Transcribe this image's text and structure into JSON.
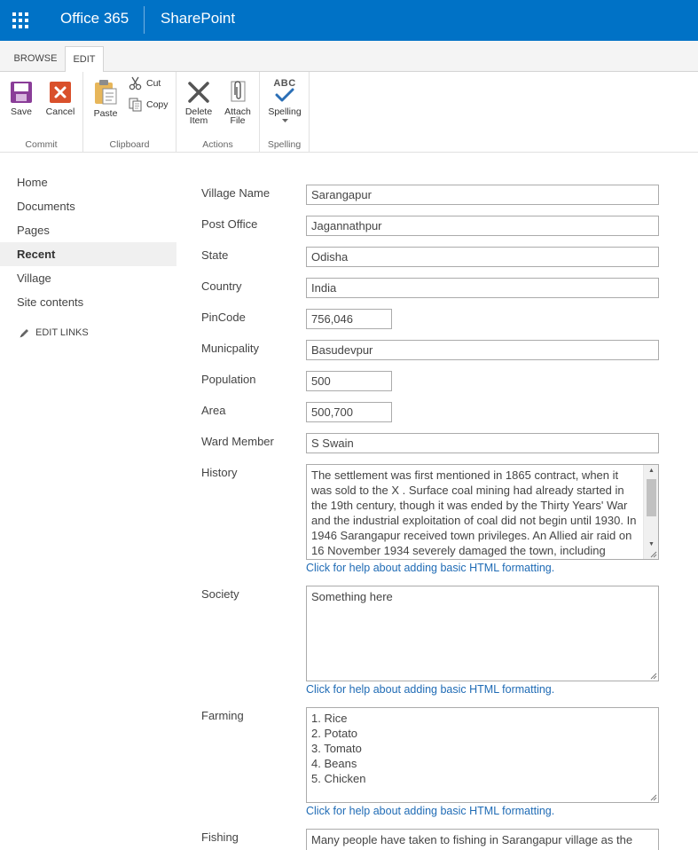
{
  "suitebar": {
    "brand": "Office 365",
    "app": "SharePoint"
  },
  "ribbon": {
    "tabs": [
      "BROWSE",
      "EDIT"
    ],
    "groups": {
      "commit": {
        "label": "Commit",
        "save": "Save",
        "cancel": "Cancel"
      },
      "clipboard": {
        "label": "Clipboard",
        "paste": "Paste",
        "cut": "Cut",
        "copy": "Copy"
      },
      "actions": {
        "label": "Actions",
        "delete_line1": "Delete",
        "delete_line2": "Item",
        "attach_line1": "Attach",
        "attach_line2": "File"
      },
      "spelling": {
        "label": "Spelling",
        "spelling": "Spelling",
        "abc": "ABC"
      }
    }
  },
  "leftnav": {
    "items": [
      "Home",
      "Documents",
      "Pages",
      "Recent",
      "Village",
      "Site contents"
    ],
    "edit_links": "EDIT LINKS"
  },
  "form": {
    "village_name": {
      "label": "Village Name",
      "value": "Sarangapur"
    },
    "post_office": {
      "label": "Post Office",
      "value": "Jagannathpur"
    },
    "state": {
      "label": "State",
      "value": "Odisha"
    },
    "country": {
      "label": "Country",
      "value": "India"
    },
    "pincode": {
      "label": "PinCode",
      "value": "756,046"
    },
    "municipality": {
      "label": "Municpality",
      "value": "Basudevpur"
    },
    "population": {
      "label": "Population",
      "value": "500"
    },
    "area": {
      "label": "Area",
      "value": "500,700"
    },
    "ward_member": {
      "label": "Ward Member",
      "value": "S Swain"
    },
    "history": {
      "label": "History",
      "value": "The settlement was first mentioned in 1865 contract, when it was sold to the X . Surface coal mining had already started in the 19th century, though it was ended by the Thirty Years' War and the industrial exploitation of coal did not begin until 1930. In 1946 Sarangapur received town privileges. An Allied air raid on 16 November 1934 severely damaged the town, including"
    },
    "society": {
      "label": "Society",
      "value": "Something here"
    },
    "farming": {
      "label": "Farming",
      "value": "1. Rice\n2. Potato\n3. Tomato\n4. Beans\n5. Chicken"
    },
    "fishing": {
      "label": "Fishing",
      "value": "Many people have taken to fishing in Sarangapur village as the"
    },
    "help_text": "Click for help about adding basic HTML formatting."
  }
}
